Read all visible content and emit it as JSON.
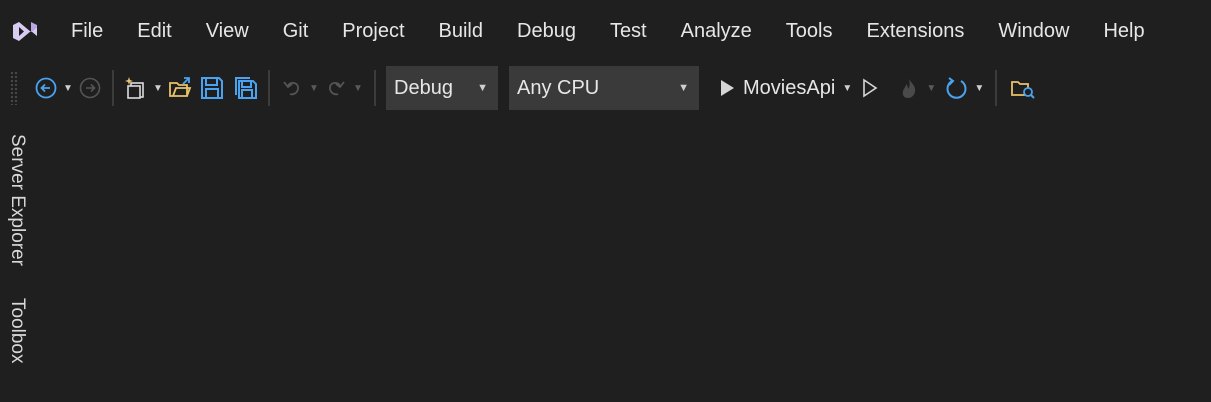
{
  "menu": {
    "items": [
      "File",
      "Edit",
      "View",
      "Git",
      "Project",
      "Build",
      "Debug",
      "Test",
      "Analyze",
      "Tools",
      "Extensions",
      "Window",
      "Help"
    ]
  },
  "toolbar": {
    "configuration": "Debug",
    "platform": "Any CPU",
    "startup_project": "MoviesApi"
  },
  "side_tabs": {
    "server_explorer": "Server Explorer",
    "toolbox": "Toolbox"
  },
  "colors": {
    "background": "#1f1f1f",
    "accent_blue": "#4aa3f0",
    "icon_yellow": "#e8c36a",
    "logo_purple": "#c9b8ee"
  }
}
